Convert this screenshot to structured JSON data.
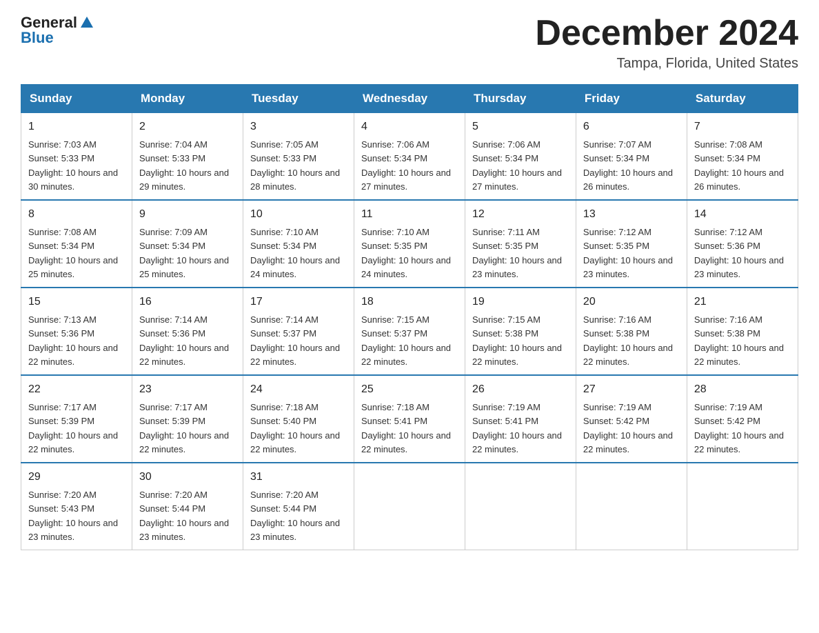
{
  "logo": {
    "text_general": "General",
    "text_blue": "Blue"
  },
  "title": "December 2024",
  "location": "Tampa, Florida, United States",
  "days_of_week": [
    "Sunday",
    "Monday",
    "Tuesday",
    "Wednesday",
    "Thursday",
    "Friday",
    "Saturday"
  ],
  "weeks": [
    [
      {
        "day": "1",
        "sunrise": "7:03 AM",
        "sunset": "5:33 PM",
        "daylight": "10 hours and 30 minutes."
      },
      {
        "day": "2",
        "sunrise": "7:04 AM",
        "sunset": "5:33 PM",
        "daylight": "10 hours and 29 minutes."
      },
      {
        "day": "3",
        "sunrise": "7:05 AM",
        "sunset": "5:33 PM",
        "daylight": "10 hours and 28 minutes."
      },
      {
        "day": "4",
        "sunrise": "7:06 AM",
        "sunset": "5:34 PM",
        "daylight": "10 hours and 27 minutes."
      },
      {
        "day": "5",
        "sunrise": "7:06 AM",
        "sunset": "5:34 PM",
        "daylight": "10 hours and 27 minutes."
      },
      {
        "day": "6",
        "sunrise": "7:07 AM",
        "sunset": "5:34 PM",
        "daylight": "10 hours and 26 minutes."
      },
      {
        "day": "7",
        "sunrise": "7:08 AM",
        "sunset": "5:34 PM",
        "daylight": "10 hours and 26 minutes."
      }
    ],
    [
      {
        "day": "8",
        "sunrise": "7:08 AM",
        "sunset": "5:34 PM",
        "daylight": "10 hours and 25 minutes."
      },
      {
        "day": "9",
        "sunrise": "7:09 AM",
        "sunset": "5:34 PM",
        "daylight": "10 hours and 25 minutes."
      },
      {
        "day": "10",
        "sunrise": "7:10 AM",
        "sunset": "5:34 PM",
        "daylight": "10 hours and 24 minutes."
      },
      {
        "day": "11",
        "sunrise": "7:10 AM",
        "sunset": "5:35 PM",
        "daylight": "10 hours and 24 minutes."
      },
      {
        "day": "12",
        "sunrise": "7:11 AM",
        "sunset": "5:35 PM",
        "daylight": "10 hours and 23 minutes."
      },
      {
        "day": "13",
        "sunrise": "7:12 AM",
        "sunset": "5:35 PM",
        "daylight": "10 hours and 23 minutes."
      },
      {
        "day": "14",
        "sunrise": "7:12 AM",
        "sunset": "5:36 PM",
        "daylight": "10 hours and 23 minutes."
      }
    ],
    [
      {
        "day": "15",
        "sunrise": "7:13 AM",
        "sunset": "5:36 PM",
        "daylight": "10 hours and 22 minutes."
      },
      {
        "day": "16",
        "sunrise": "7:14 AM",
        "sunset": "5:36 PM",
        "daylight": "10 hours and 22 minutes."
      },
      {
        "day": "17",
        "sunrise": "7:14 AM",
        "sunset": "5:37 PM",
        "daylight": "10 hours and 22 minutes."
      },
      {
        "day": "18",
        "sunrise": "7:15 AM",
        "sunset": "5:37 PM",
        "daylight": "10 hours and 22 minutes."
      },
      {
        "day": "19",
        "sunrise": "7:15 AM",
        "sunset": "5:38 PM",
        "daylight": "10 hours and 22 minutes."
      },
      {
        "day": "20",
        "sunrise": "7:16 AM",
        "sunset": "5:38 PM",
        "daylight": "10 hours and 22 minutes."
      },
      {
        "day": "21",
        "sunrise": "7:16 AM",
        "sunset": "5:38 PM",
        "daylight": "10 hours and 22 minutes."
      }
    ],
    [
      {
        "day": "22",
        "sunrise": "7:17 AM",
        "sunset": "5:39 PM",
        "daylight": "10 hours and 22 minutes."
      },
      {
        "day": "23",
        "sunrise": "7:17 AM",
        "sunset": "5:39 PM",
        "daylight": "10 hours and 22 minutes."
      },
      {
        "day": "24",
        "sunrise": "7:18 AM",
        "sunset": "5:40 PM",
        "daylight": "10 hours and 22 minutes."
      },
      {
        "day": "25",
        "sunrise": "7:18 AM",
        "sunset": "5:41 PM",
        "daylight": "10 hours and 22 minutes."
      },
      {
        "day": "26",
        "sunrise": "7:19 AM",
        "sunset": "5:41 PM",
        "daylight": "10 hours and 22 minutes."
      },
      {
        "day": "27",
        "sunrise": "7:19 AM",
        "sunset": "5:42 PM",
        "daylight": "10 hours and 22 minutes."
      },
      {
        "day": "28",
        "sunrise": "7:19 AM",
        "sunset": "5:42 PM",
        "daylight": "10 hours and 22 minutes."
      }
    ],
    [
      {
        "day": "29",
        "sunrise": "7:20 AM",
        "sunset": "5:43 PM",
        "daylight": "10 hours and 23 minutes."
      },
      {
        "day": "30",
        "sunrise": "7:20 AM",
        "sunset": "5:44 PM",
        "daylight": "10 hours and 23 minutes."
      },
      {
        "day": "31",
        "sunrise": "7:20 AM",
        "sunset": "5:44 PM",
        "daylight": "10 hours and 23 minutes."
      },
      null,
      null,
      null,
      null
    ]
  ],
  "labels": {
    "sunrise": "Sunrise:",
    "sunset": "Sunset:",
    "daylight": "Daylight:"
  }
}
